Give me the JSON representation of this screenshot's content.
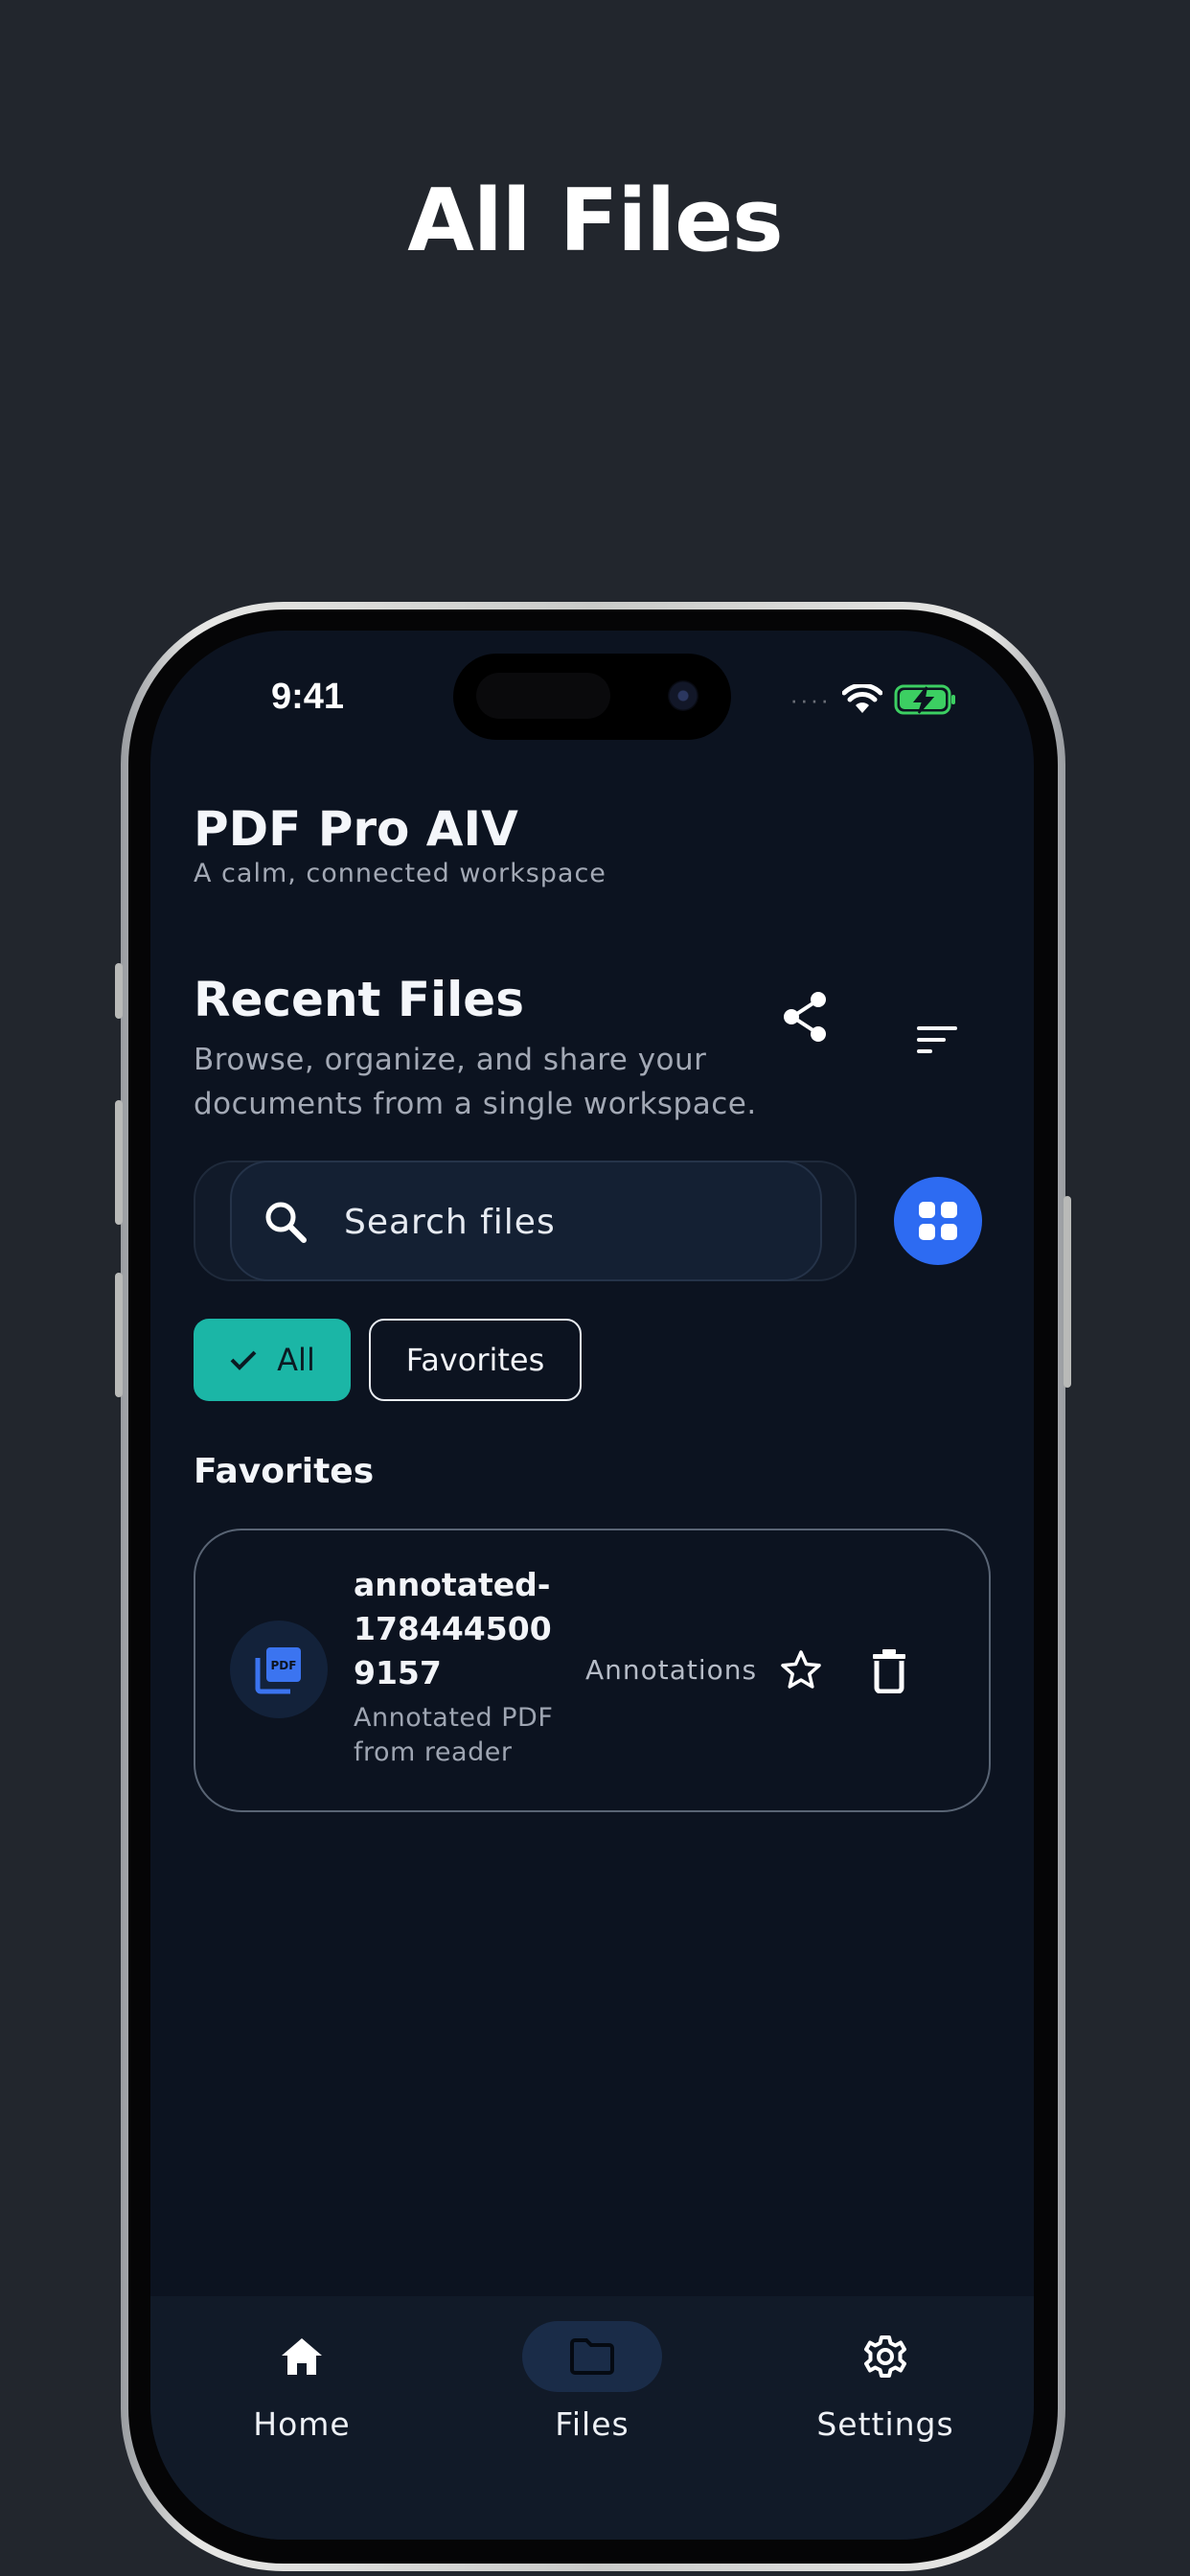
{
  "headline": "All Files",
  "status_bar": {
    "time": "9:41",
    "signal": "····"
  },
  "app": {
    "title": "PDF Pro AIV",
    "subtitle": "A calm, connected workspace"
  },
  "section": {
    "title": "Recent Files",
    "description": "Browse, organize, and share your documents from a single workspace."
  },
  "search": {
    "placeholder": "Search files",
    "value": ""
  },
  "filters": [
    {
      "label": "All",
      "selected": true
    },
    {
      "label": "Favorites",
      "selected": false
    }
  ],
  "favorites": {
    "heading": "Favorites",
    "items": [
      {
        "name": "annotated-1784445009157",
        "description": "Annotated PDF from reader",
        "tag": "Annotations",
        "icon": "pdf-file-icon",
        "badge": "PDF"
      }
    ]
  },
  "nav": {
    "items": [
      {
        "label": "Home",
        "icon": "home-icon",
        "active": false
      },
      {
        "label": "Files",
        "icon": "folder-icon",
        "active": true
      },
      {
        "label": "Settings",
        "icon": "gear-icon",
        "active": false
      }
    ]
  },
  "colors": {
    "background": "#22262d",
    "screen": "#0c1320",
    "accent_teal": "#1bb6a6",
    "accent_blue": "#2d6bf2",
    "battery_green": "#3ccf62"
  }
}
